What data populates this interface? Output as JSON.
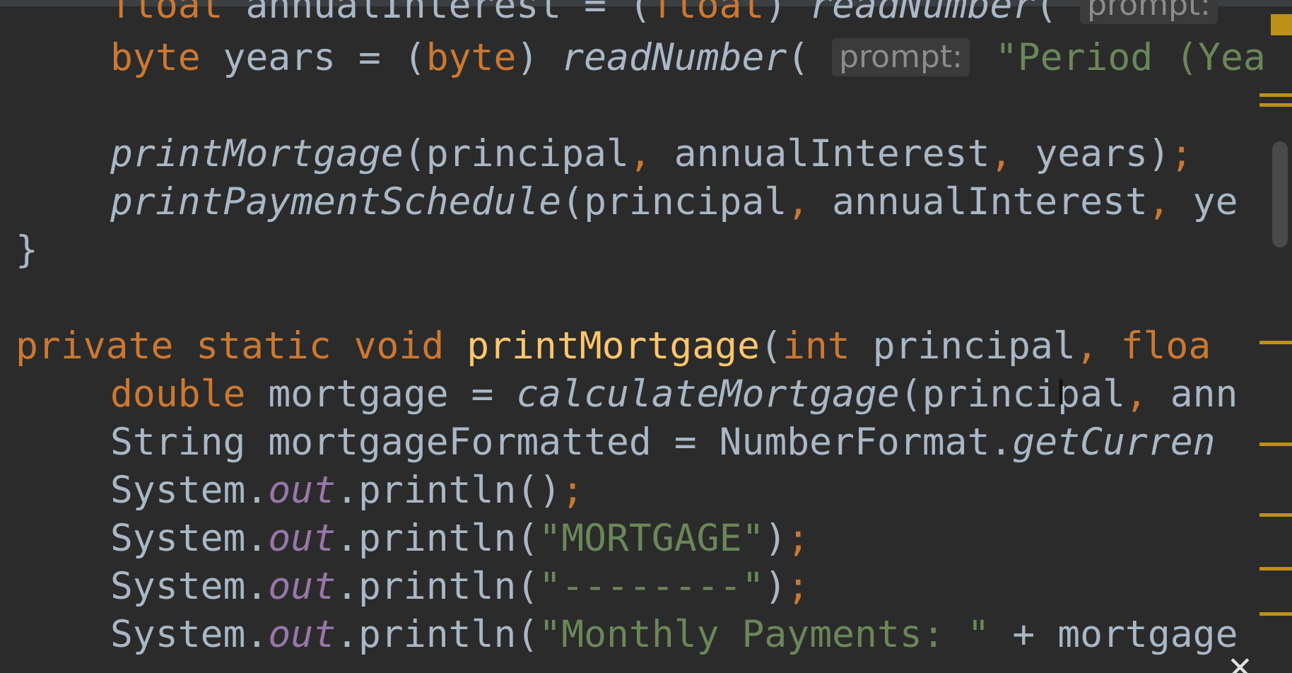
{
  "code": {
    "line0": {
      "kw": "float",
      "name": " annualInterest = (",
      "cast": "float",
      "close": ") ",
      "call": "readNumber",
      "paren": "( ",
      "hint": "prompt:"
    },
    "line1": {
      "kw": "byte",
      "name": " years = (",
      "cast": "byte",
      "close": ") ",
      "call": "readNumber",
      "paren": "( ",
      "hint": "prompt:",
      "arg": " \"Period (Yea"
    },
    "line2": {
      "call": "printMortgage",
      "args": "(principal",
      "comma1": ", ",
      "arg2": "annualInterest",
      "comma2": ", ",
      "arg3": "years)",
      "semi": ";"
    },
    "line3": {
      "call": "printPaymentSchedule",
      "args": "(principal",
      "comma1": ", ",
      "arg2": "annualInterest",
      "comma2": ", ",
      "arg3": "ye"
    },
    "line4": {
      "brace": "}"
    },
    "line5": {
      "mods": "private static void ",
      "name": "printMortgage",
      "paren": "(",
      "type1": "int",
      "param1": " principal",
      "comma": ", ",
      "type2": "floa"
    },
    "line6": {
      "type": "double",
      "var": " mortgage = ",
      "call": "calculateMortgage",
      "args": "(principal",
      "comma": ", ",
      "rest": "ann"
    },
    "line7": {
      "decl": "String mortgageFormatted = NumberFormat.",
      "call": "getCurren"
    },
    "line8": {
      "obj": "System.",
      "field": "out",
      "call": ".println()",
      "semi": ";"
    },
    "line9": {
      "obj": "System.",
      "field": "out",
      "call": ".println(",
      "str": "\"MORTGAGE\"",
      "close": ")",
      "semi": ";"
    },
    "line10": {
      "obj": "System.",
      "field": "out",
      "call": ".println(",
      "str": "\"--------\"",
      "close": ")",
      "semi": ";"
    },
    "line11": {
      "obj": "System.",
      "field": "out",
      "call": ".println(",
      "str": "\"Monthly Payments: \"",
      "rest": " + mortgage"
    }
  },
  "icons": {
    "cursor": "I",
    "close": "✕"
  },
  "colors": {
    "background": "#2b2b2b",
    "keyword": "#cc7832",
    "function_decl": "#ffc66d",
    "string": "#6a8759",
    "field": "#9876aa",
    "default_text": "#a9b7c6",
    "marker": "#be9117"
  }
}
